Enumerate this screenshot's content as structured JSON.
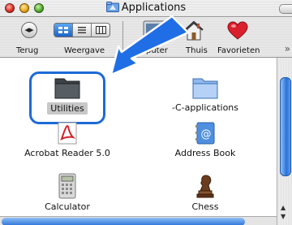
{
  "window": {
    "title": "Applications"
  },
  "toolbar": {
    "back_label": "Terug",
    "view_label": "Weergave",
    "computer_label": "puter",
    "home_label": "Thuis",
    "favorites_label": "Favorieten",
    "overflow_glyph": "»"
  },
  "items": [
    {
      "label": "Utilities",
      "icon": "folder-icon",
      "selected": true
    },
    {
      "label": "-C-applications",
      "icon": "folder-icon",
      "selected": false
    },
    {
      "label": "Acrobat Reader 5.0",
      "icon": "acrobat-icon",
      "selected": false
    },
    {
      "label": "Address Book",
      "icon": "address-book-icon",
      "selected": false
    },
    {
      "label": "Calculator",
      "icon": "calculator-icon",
      "selected": false
    },
    {
      "label": "Chess",
      "icon": "chess-icon",
      "selected": false
    }
  ],
  "colors": {
    "accent": "#1d6ad6",
    "arrow": "#1f6ee6"
  }
}
